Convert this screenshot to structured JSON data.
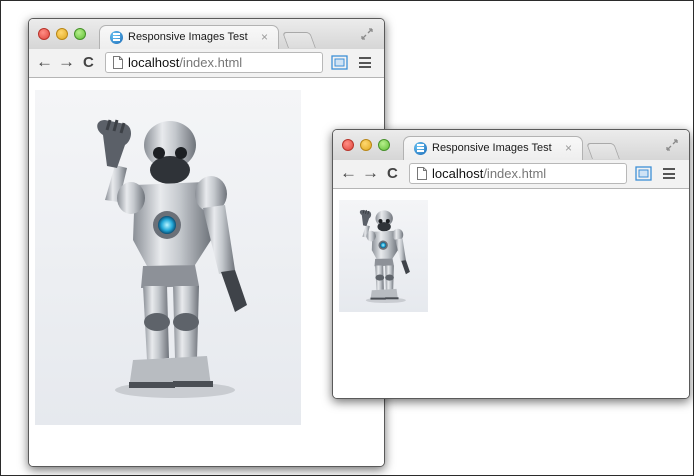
{
  "browser_large": {
    "tab_title": "Responsive Images Test",
    "tab_close": "×",
    "url_host": "localhost",
    "url_path": "/index.html",
    "nav": {
      "back": "←",
      "forward": "→",
      "reload": "C"
    },
    "image_alt": "robot-image"
  },
  "browser_small": {
    "tab_title": "Responsive Images Test",
    "tab_close": "×",
    "url_host": "localhost",
    "url_path": "/index.html",
    "nav": {
      "back": "←",
      "forward": "→",
      "reload": "C"
    },
    "image_alt": "robot-image"
  },
  "icons": {
    "favicon": "chrome-logo-icon",
    "page": "page-icon",
    "cast": "cast-icon",
    "menu": "hamburger-menu-icon",
    "fullscreen": "fullscreen-icon"
  },
  "colors": {
    "close": "#e0443b",
    "minimize": "#e0a81f",
    "maximize": "#5fbf34",
    "cast_accent": "#3d8fd6"
  }
}
